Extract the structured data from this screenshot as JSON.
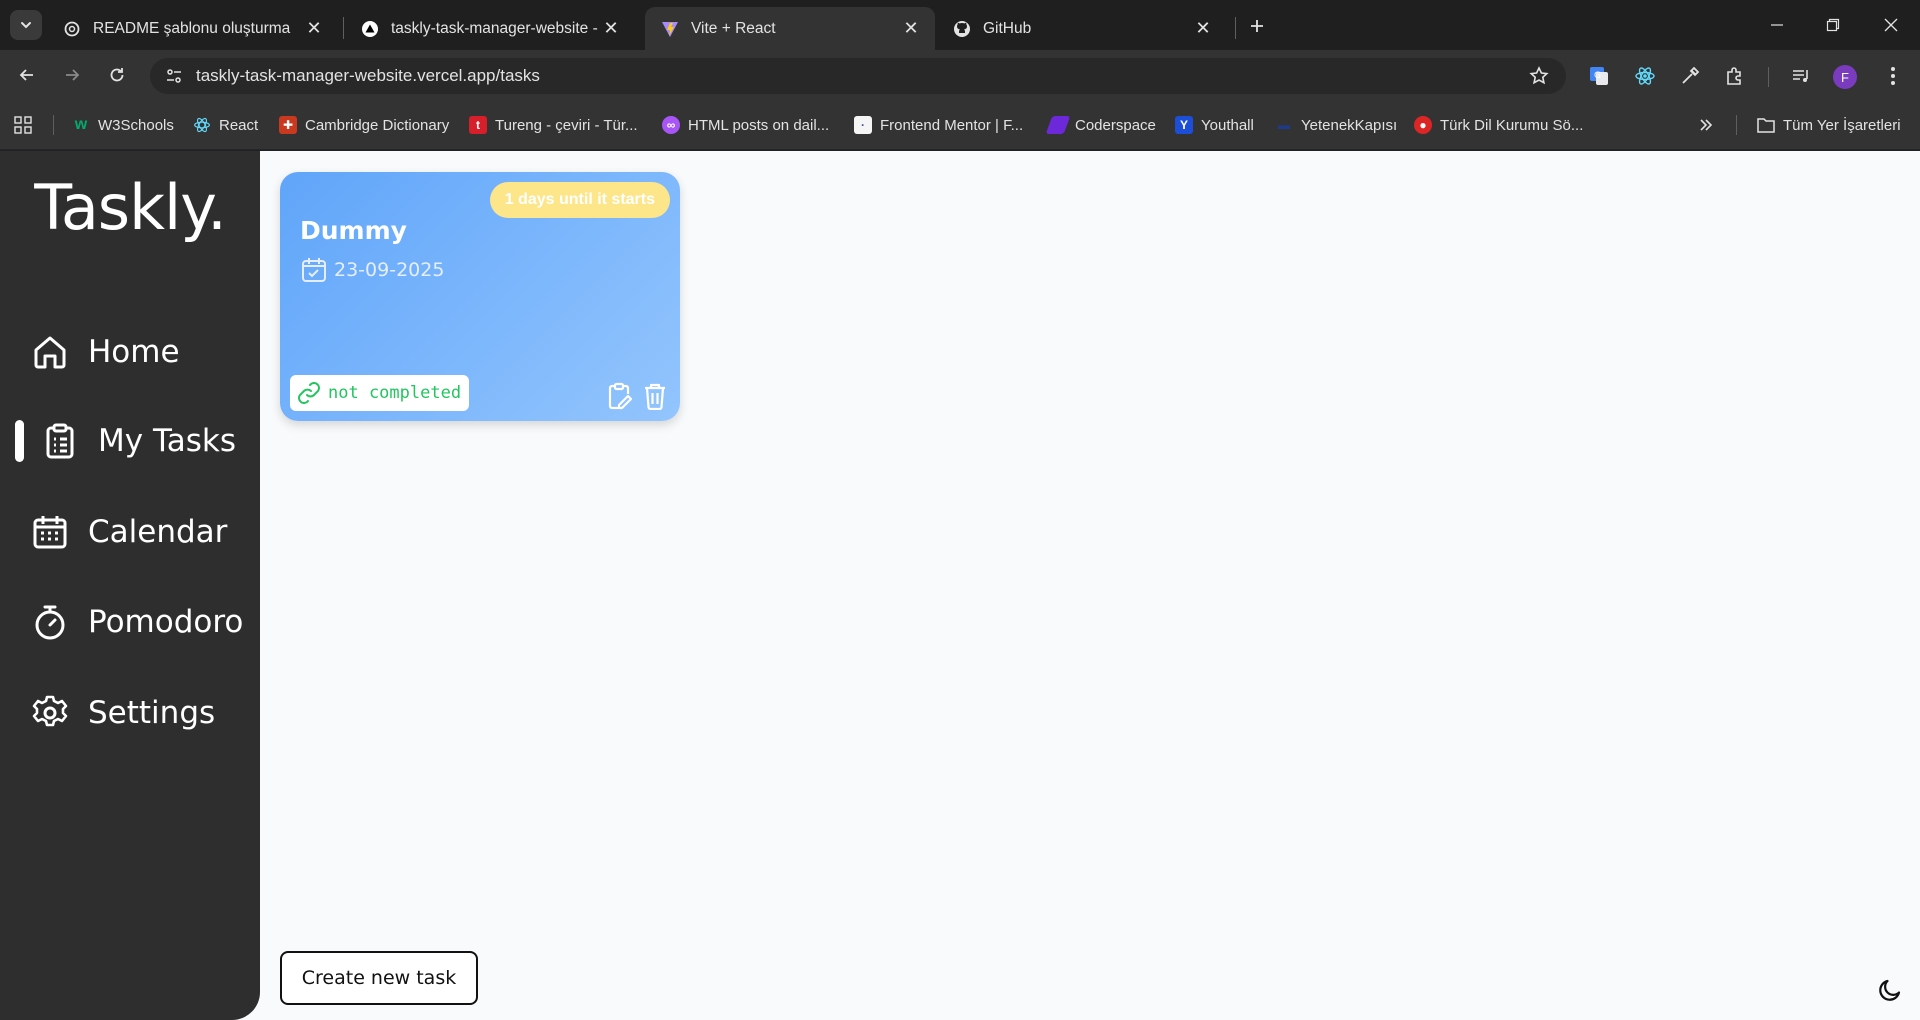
{
  "browser": {
    "tabs": [
      {
        "title": "README şablonu oluşturma",
        "active": false
      },
      {
        "title": "taskly-task-manager-website - ",
        "active": false
      },
      {
        "title": "Vite + React",
        "active": true
      },
      {
        "title": "GitHub",
        "active": false
      }
    ],
    "url": "taskly-task-manager-website.vercel.app/tasks",
    "avatar_letter": "F",
    "bookmarks": [
      "W3Schools",
      "React",
      "Cambridge Dictionary",
      "Tureng - çeviri - Tür...",
      "HTML posts on dail...",
      "Frontend Mentor | F...",
      "Coderspace",
      "Youthall",
      "YetenekKapısı",
      "Türk Dil Kurumu Sö..."
    ],
    "all_bookmarks": "Tüm Yer İşaretleri"
  },
  "app": {
    "logo": "Taskly.",
    "nav": [
      {
        "label": "Home",
        "icon": "home-icon"
      },
      {
        "label": "My Tasks",
        "icon": "clipboard-list-icon",
        "active": true
      },
      {
        "label": "Calendar",
        "icon": "calendar-icon"
      },
      {
        "label": "Pomodoro",
        "icon": "stopwatch-icon"
      },
      {
        "label": "Settings",
        "icon": "gear-icon"
      }
    ],
    "task": {
      "badge": "1 days until it starts",
      "title": "Dummy",
      "date": "23-09-2025",
      "status": "not completed"
    },
    "create_button": "Create new task"
  },
  "colors": {
    "sidebar": "#2e2e2e",
    "card_gradient_start": "#60a5fa",
    "card_gradient_end": "#93c5fd",
    "badge": "#fde68a",
    "status_text": "#22c55e"
  }
}
